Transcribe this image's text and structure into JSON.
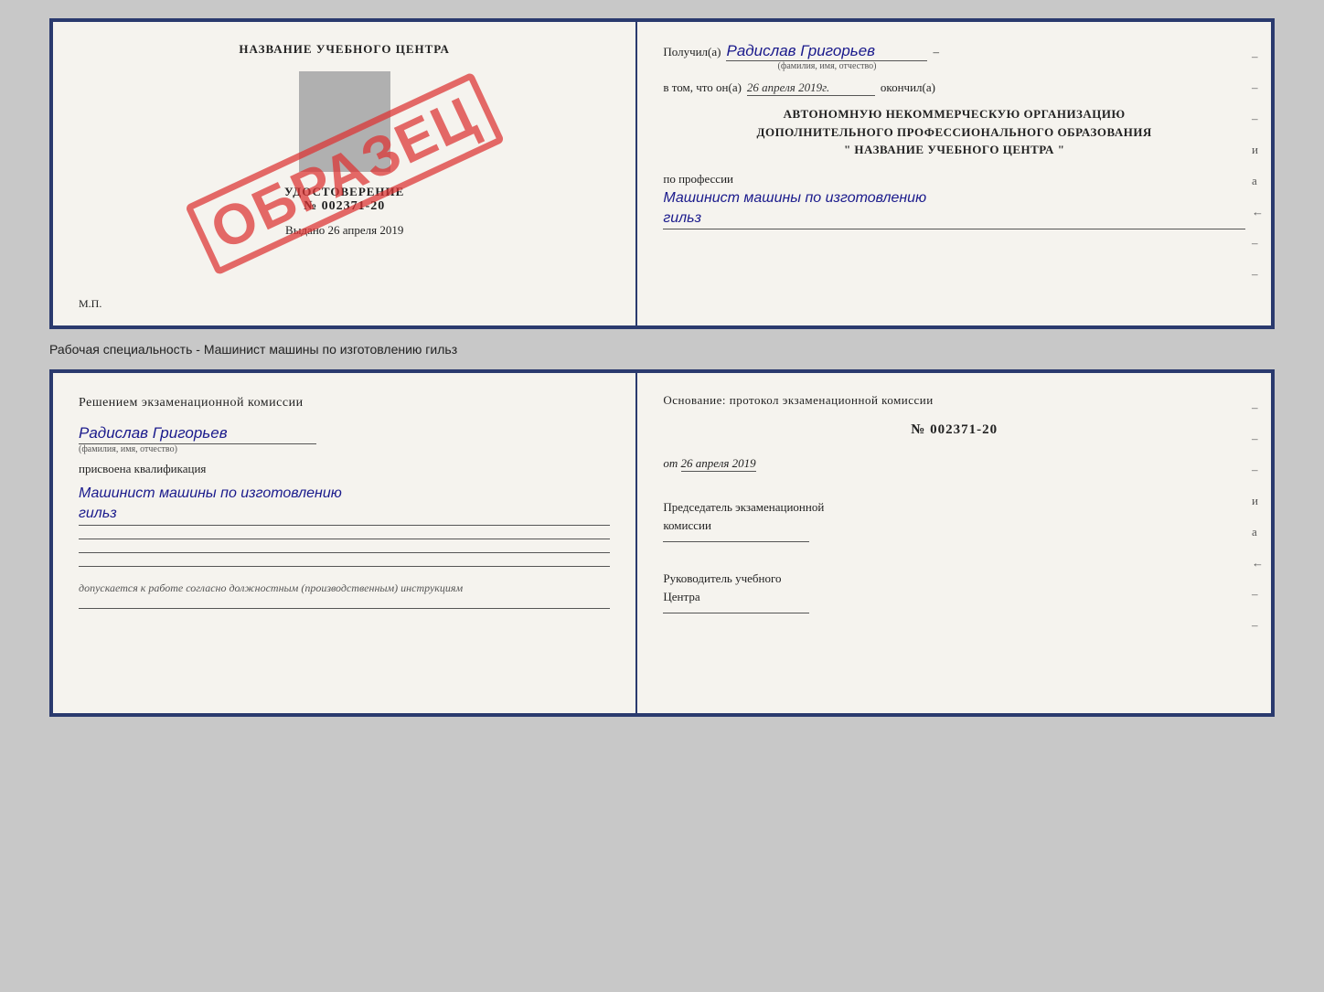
{
  "cert": {
    "left": {
      "title": "НАЗВАНИЕ УЧЕБНОГО ЦЕНТРА",
      "stamp": "ОБРАЗЕЦ",
      "udost_label": "УДОСТОВЕРЕНИЕ",
      "number": "№ 002371-20",
      "vydano_prefix": "Выдано",
      "vydano_date": "26 апреля 2019",
      "mp": "М.П."
    },
    "right": {
      "poluchil_prefix": "Получил(а)",
      "poluchil_value": "Радислав Григорьев",
      "poluchil_sublabel": "(фамилия, имя, отчество)",
      "vtom_prefix": "в том, что он(а)",
      "vtom_date": "26 апреля 2019г.",
      "okonchill": "окончил(а)",
      "org_line1": "АВТОНОМНУЮ НЕКОММЕРЧЕСКУЮ ОРГАНИЗАЦИЮ",
      "org_line2": "ДОПОЛНИТЕЛЬНОГО ПРОФЕССИОНАЛЬНОГО ОБРАЗОВАНИЯ",
      "org_line3": "\" НАЗВАНИЕ УЧЕБНОГО ЦЕНТРА \"",
      "po_professii": "по профессии",
      "profession": "Машинист машины по изготовлению",
      "profession2": "гильз",
      "dashes": [
        "-",
        "-",
        "-",
        "и",
        "а",
        "←",
        "-",
        "-",
        "-"
      ]
    }
  },
  "doc_label": "Рабочая специальность - Машинист машины по изготовлению гильз",
  "qual": {
    "left": {
      "reshen_label": "Решением  экзаменационной  комиссии",
      "name_value": "Радислав Григорьев",
      "name_sublabel": "(фамилия, имя, отчество)",
      "prisvoen_label": "присвоена квалификация",
      "profession": "Машинист машины по изготовлению",
      "profession2": "гильз",
      "dopusk_label": "допускается к  работе согласно должностным (производственным) инструкциям"
    },
    "right": {
      "osnov_label": "Основание: протокол экзаменационной  комиссии",
      "number": "№  002371-20",
      "ot_prefix": "от",
      "ot_date": "26 апреля 2019",
      "predsed_line1": "Председатель экзаменационной",
      "predsed_line2": "комиссии",
      "rukov_line1": "Руководитель учебного",
      "rukov_line2": "Центра",
      "dashes": [
        "-",
        "-",
        "-",
        "и",
        "а",
        "←",
        "-",
        "-",
        "-"
      ]
    }
  }
}
